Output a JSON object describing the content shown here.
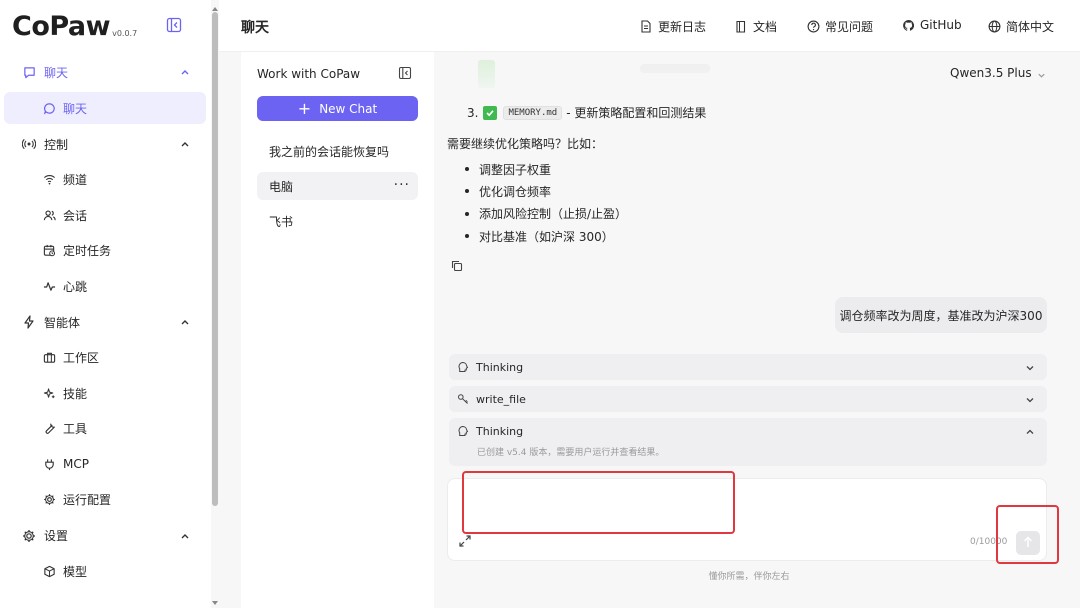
{
  "app": {
    "logo": "CoPaw",
    "version": "v0.0.7"
  },
  "sidebar": {
    "groups": [
      {
        "label": "聊天",
        "items": [
          {
            "label": "聊天"
          }
        ]
      },
      {
        "label": "控制",
        "items": [
          {
            "label": "频道"
          },
          {
            "label": "会话"
          },
          {
            "label": "定时任务"
          },
          {
            "label": "心跳"
          }
        ]
      },
      {
        "label": "智能体",
        "items": [
          {
            "label": "工作区"
          },
          {
            "label": "技能"
          },
          {
            "label": "工具"
          },
          {
            "label": "MCP"
          },
          {
            "label": "运行配置"
          }
        ]
      },
      {
        "label": "设置",
        "items": [
          {
            "label": "模型"
          }
        ]
      }
    ]
  },
  "header": {
    "title": "聊天",
    "links": [
      {
        "label": "更新日志",
        "icon": "doc-icon"
      },
      {
        "label": "文档",
        "icon": "book-icon"
      },
      {
        "label": "常见问题",
        "icon": "help-icon"
      },
      {
        "label": "GitHub",
        "icon": "github-icon"
      },
      {
        "label": "简体中文",
        "icon": "globe-icon"
      }
    ]
  },
  "chat_list": {
    "title": "Work with CoPaw",
    "new_chat_label": "New Chat",
    "items": [
      {
        "label": "我之前的会话能恢复吗"
      },
      {
        "label": "电脑"
      },
      {
        "label": "飞书"
      }
    ],
    "more_label": "···"
  },
  "chat": {
    "model": "Qwen3.5 Plus",
    "step": {
      "num": "3.",
      "code": "MEMORY.md",
      "text": "- 更新策略配置和回测结果"
    },
    "question": "需要继续优化策略吗？比如：",
    "bullets": [
      "调整因子权重",
      "优化调仓频率",
      "添加风险控制（止损/止盈）",
      "对比基准（如沪深 300）"
    ],
    "user_message": "调仓频率改为周度，基准改为沪深300",
    "accordions": [
      {
        "label": "Thinking"
      },
      {
        "label": "write_file"
      }
    ],
    "open_accordion": {
      "label": "Thinking",
      "detail": "已创建 v5.4 版本，需要用户运行并查看结果。"
    },
    "composer": {
      "placeholder": "",
      "counter": "0/10000"
    },
    "footer": "懂你所需，伴你左右"
  },
  "colors": {
    "accent": "#6c63f2",
    "annotation": "#e0383e",
    "check": "#3fb950"
  }
}
